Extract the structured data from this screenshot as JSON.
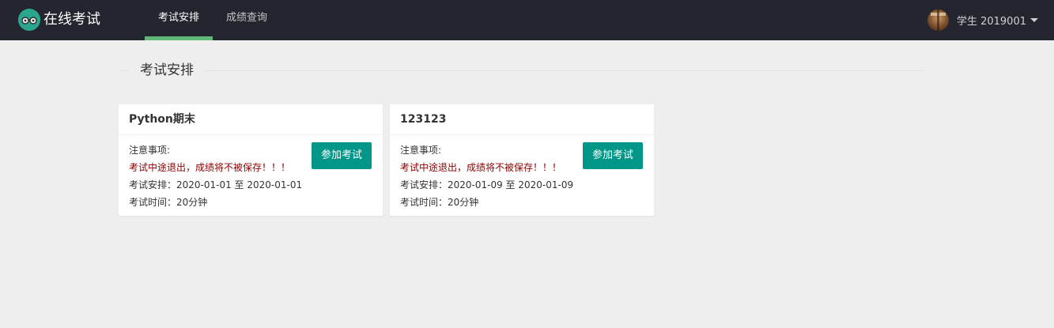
{
  "header": {
    "app_title": "在线考试",
    "nav": [
      {
        "label": "考试安排",
        "active": true
      },
      {
        "label": "成绩查询",
        "active": false
      }
    ],
    "user": {
      "name": "学生 2019001"
    }
  },
  "section": {
    "title": "考试安排"
  },
  "exams": [
    {
      "title": "Python期末",
      "notice_label": "注意事项:",
      "warning": "考试中途退出，成绩将不被保存！！！",
      "schedule": "考试安排：2020-01-01 至 2020-01-01",
      "duration": "考试时间：20分钟",
      "button": "参加考试"
    },
    {
      "title": "123123",
      "notice_label": "注意事项:",
      "warning": "考试中途退出，成绩将不被保存！！！",
      "schedule": "考试安排：2020-01-09 至 2020-01-09",
      "duration": "考试时间：20分钟",
      "button": "参加考试"
    }
  ],
  "colors": {
    "header_bg": "#23262e",
    "nav_active_bar": "#5fb878",
    "button": "#009688",
    "warning_text": "#8b0000"
  }
}
